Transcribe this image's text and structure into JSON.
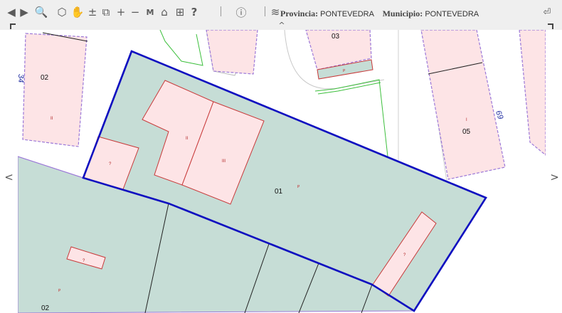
{
  "toolbar": {
    "icons": [
      {
        "name": "back-arrow-icon",
        "glyph": "◀"
      },
      {
        "name": "forward-arrow-icon",
        "glyph": "▶"
      },
      {
        "name": "search-icon",
        "glyph": "🔍"
      },
      {
        "name": "3d-view-icon",
        "glyph": "⬡"
      },
      {
        "name": "pan-hand-icon",
        "glyph": "✋"
      },
      {
        "name": "zoom-in-out-icon",
        "glyph": "±"
      },
      {
        "name": "layers-icon",
        "glyph": "⧉"
      },
      {
        "name": "zoom-in-icon",
        "glyph": "+"
      },
      {
        "name": "zoom-out-icon",
        "glyph": "−"
      },
      {
        "name": "measure-icon",
        "glyph": "M"
      },
      {
        "name": "building-icon",
        "glyph": "⌂"
      },
      {
        "name": "legend-icon",
        "glyph": "⊞"
      },
      {
        "name": "help-icon",
        "glyph": "?"
      },
      {
        "name": "info-marker-icon",
        "glyph": "ⓘ"
      },
      {
        "name": "layer-stack-icon",
        "glyph": "≋"
      }
    ],
    "provincia_label": "Provincia:",
    "provincia_value": "PONTEVEDRA",
    "municipio_label": "Municipio:",
    "municipio_value": "PONTEVEDRA",
    "logout_icon": "⏎",
    "collapse_icon": "^"
  },
  "nav": {
    "left_arrow": "<",
    "right_arrow": ">"
  },
  "map": {
    "colors": {
      "parcel_fill": "#c6ddd6",
      "building_fill": "#fde4e6",
      "building_stroke": "#c83a3a",
      "selected_outline": "#1010c0",
      "boundary_lilac": "#9c78d8",
      "road_green": "#3cbf3c"
    },
    "labels": {
      "street_number_left": "34",
      "street_number_right": "69",
      "parcel_02_top": "02",
      "parcel_03": "03",
      "parcel_05": "05",
      "parcel_01": "01",
      "parcel_02_bottom": "02",
      "floors_ii_left": "II",
      "floors_ii_center": "II",
      "floors_iii": "III",
      "floors_i_right": "I",
      "floors_unknown_small": "?",
      "floors_unknown_lower": "?",
      "floors_unknown_diagonal": "?",
      "marker_p_03": "P",
      "marker_p_01": "P",
      "marker_p_02": "P"
    }
  }
}
